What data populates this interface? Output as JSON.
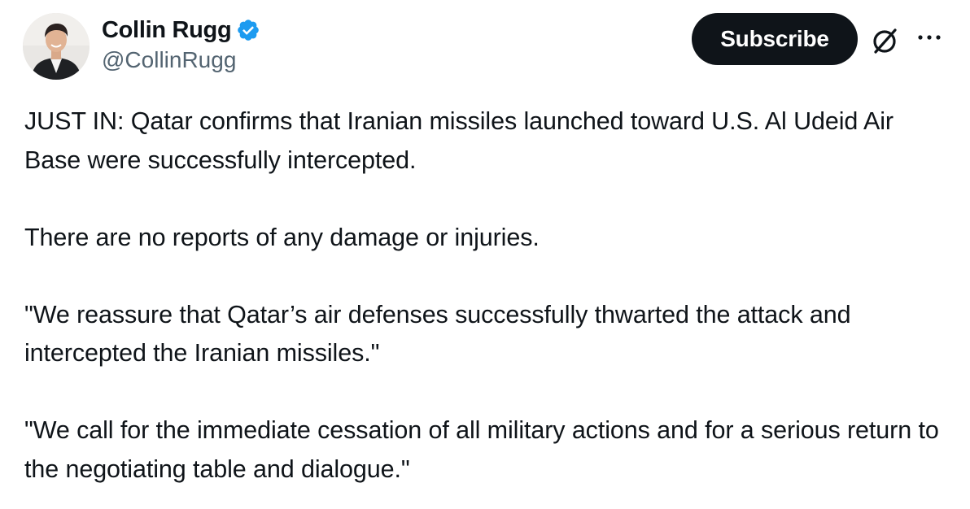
{
  "author": {
    "display_name": "Collin Rugg",
    "handle": "@CollinRugg",
    "verified": true,
    "avatar_icon": "profile-photo"
  },
  "actions": {
    "subscribe_label": "Subscribe",
    "grok_icon": "grok-icon",
    "more_icon": "more-options-icon"
  },
  "tweet": {
    "paragraphs": [
      "JUST IN: Qatar confirms that Iranian missiles launched toward U.S. Al Udeid Air Base were successfully intercepted.",
      "There are no reports of any damage or injuries.",
      "\"We reassure that Qatar’s air defenses successfully thwarted the attack and intercepted the Iranian missiles.\"",
      "\"We call for the immediate cessation of all military actions and for a serious return to the negotiating table and dialogue.\""
    ]
  },
  "colors": {
    "text_primary": "#0f1419",
    "text_secondary": "#536471",
    "verified_blue": "#1d9bf0",
    "button_bg": "#0f1419"
  }
}
